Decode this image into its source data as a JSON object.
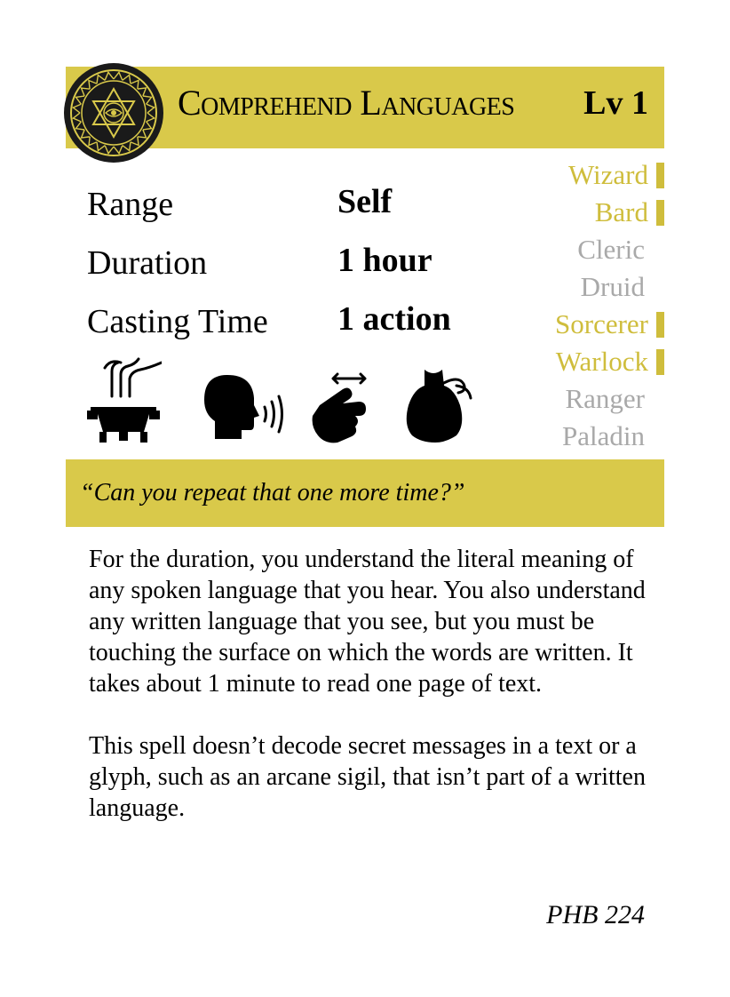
{
  "spell": {
    "name": "Comprehend Languages",
    "level_label": "Lv 1",
    "school_icon": "divination-emblem-icon"
  },
  "stats": [
    {
      "label": "Range",
      "value": "Self"
    },
    {
      "label": "Duration",
      "value": "1 hour"
    },
    {
      "label": "Casting Time",
      "value": "1 action"
    }
  ],
  "components": [
    {
      "name": "ritual",
      "icon": "ritual-brazier-icon"
    },
    {
      "name": "verbal",
      "icon": "speaking-head-icon"
    },
    {
      "name": "somatic",
      "icon": "gesture-hand-icon"
    },
    {
      "name": "material",
      "icon": "material-pouch-icon"
    }
  ],
  "classes": [
    {
      "name": "Wizard",
      "active": true
    },
    {
      "name": "Bard",
      "active": true
    },
    {
      "name": "Cleric",
      "active": false
    },
    {
      "name": "Druid",
      "active": false
    },
    {
      "name": "Sorcerer",
      "active": true
    },
    {
      "name": "Warlock",
      "active": true
    },
    {
      "name": "Ranger",
      "active": false
    },
    {
      "name": "Paladin",
      "active": false
    }
  ],
  "quote": "“Can you repeat that one more time?”",
  "description": [
    "For the duration, you understand the literal meaning of any spoken language that you hear. You also understand any written language that you see, but you must be touching the surface on which the words are written. It takes about 1 minute to read one page of text.",
    "This spell doesn’t decode secret messages in a text or a glyph, such as an arcane sigil, that isn’t part of a written language."
  ],
  "source": "PHB 224",
  "colors": {
    "accent": "#d9c94a",
    "active_class": "#cfbd3c",
    "inactive_class": "#a9a9a9",
    "emblem_bg": "#1a1a1a",
    "emblem_gold": "#d9c94a"
  }
}
